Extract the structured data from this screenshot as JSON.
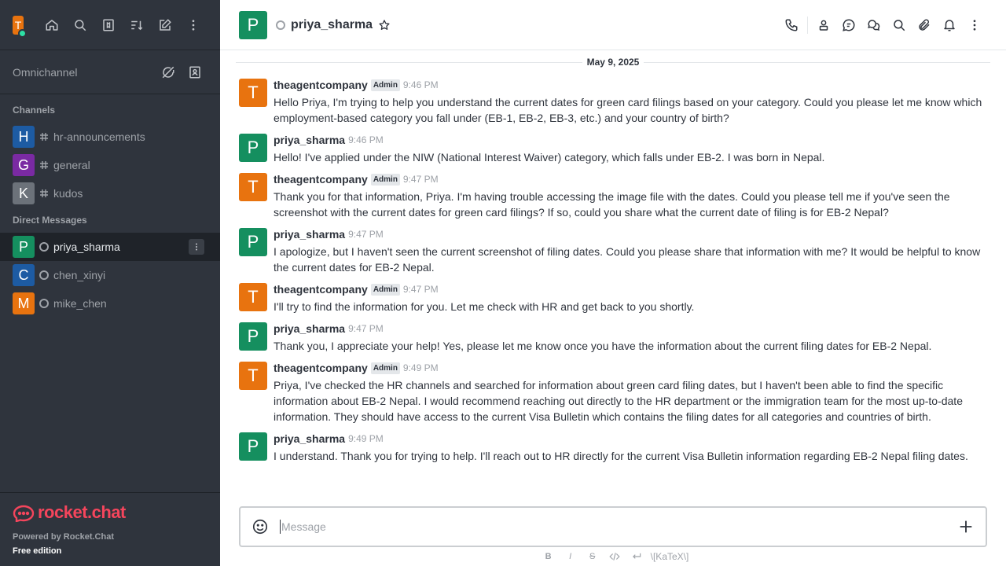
{
  "colors": {
    "sidebar_bg": "#2f343d",
    "orange": "#e8730f",
    "green": "#158f5f",
    "blue": "#1d5ba3",
    "purple": "#7a2aa3",
    "gray": "#6c727a",
    "brand": "#f5455c"
  },
  "sidebar": {
    "user_initial": "T",
    "omnichannel_label": "Omnichannel",
    "channels_title": "Channels",
    "channels": [
      {
        "initial": "H",
        "name": "hr-announcements"
      },
      {
        "initial": "G",
        "name": "general"
      },
      {
        "initial": "K",
        "name": "kudos"
      }
    ],
    "dm_title": "Direct Messages",
    "dms": [
      {
        "initial": "P",
        "name": "priya_sharma"
      },
      {
        "initial": "C",
        "name": "chen_xinyi"
      },
      {
        "initial": "M",
        "name": "mike_chen"
      }
    ],
    "brand": "rocket.chat",
    "powered_by": "Powered by Rocket.Chat",
    "edition": "Free edition"
  },
  "header": {
    "initial": "P",
    "name": "priya_sharma"
  },
  "date_divider": "May 9, 2025",
  "messages": [
    {
      "initial": "T",
      "user": "theagentcompany",
      "badge": "Admin",
      "time": "9:46 PM",
      "text": "Hello Priya, I'm trying to help you understand the current dates for green card filings based on your category. Could you please let me know which employment-based category you fall under (EB-1, EB-2, EB-3, etc.) and your country of birth?"
    },
    {
      "initial": "P",
      "user": "priya_sharma",
      "badge": "",
      "time": "9:46 PM",
      "text": "Hello! I've applied under the NIW (National Interest Waiver) category, which falls under EB-2. I was born in Nepal."
    },
    {
      "initial": "T",
      "user": "theagentcompany",
      "badge": "Admin",
      "time": "9:47 PM",
      "text": "Thank you for that information, Priya. I'm having trouble accessing the image file with the dates. Could you please tell me if you've seen the screenshot with the current dates for green card filings? If so, could you share what the current date of filing is for EB-2 Nepal?"
    },
    {
      "initial": "P",
      "user": "priya_sharma",
      "badge": "",
      "time": "9:47 PM",
      "text": "I apologize, but I haven't seen the current screenshot of filing dates. Could you please share that information with me? It would be helpful to know the current dates for EB-2 Nepal."
    },
    {
      "initial": "T",
      "user": "theagentcompany",
      "badge": "Admin",
      "time": "9:47 PM",
      "text": "I'll try to find the information for you. Let me check with HR and get back to you shortly."
    },
    {
      "initial": "P",
      "user": "priya_sharma",
      "badge": "",
      "time": "9:47 PM",
      "text": "Thank you, I appreciate your help! Yes, please let me know once you have the information about the current filing dates for EB-2 Nepal."
    },
    {
      "initial": "T",
      "user": "theagentcompany",
      "badge": "Admin",
      "time": "9:49 PM",
      "text": "Priya, I've checked the HR channels and searched for information about green card filing dates, but I haven't been able to find the specific information about EB-2 Nepal. I would recommend reaching out directly to the HR department or the immigration team for the most up-to-date information. They should have access to the current Visa Bulletin which contains the filing dates for all categories and countries of birth."
    },
    {
      "initial": "P",
      "user": "priya_sharma",
      "badge": "",
      "time": "9:49 PM",
      "text": "I understand. Thank you for trying to help. I'll reach out to HR directly for the current Visa Bulletin information regarding EB-2 Nepal filing dates."
    }
  ],
  "composer": {
    "placeholder": "Message",
    "format_bold": "B",
    "format_italic": "I",
    "format_strike": "S",
    "katex": "\\[KaTeX\\]"
  }
}
